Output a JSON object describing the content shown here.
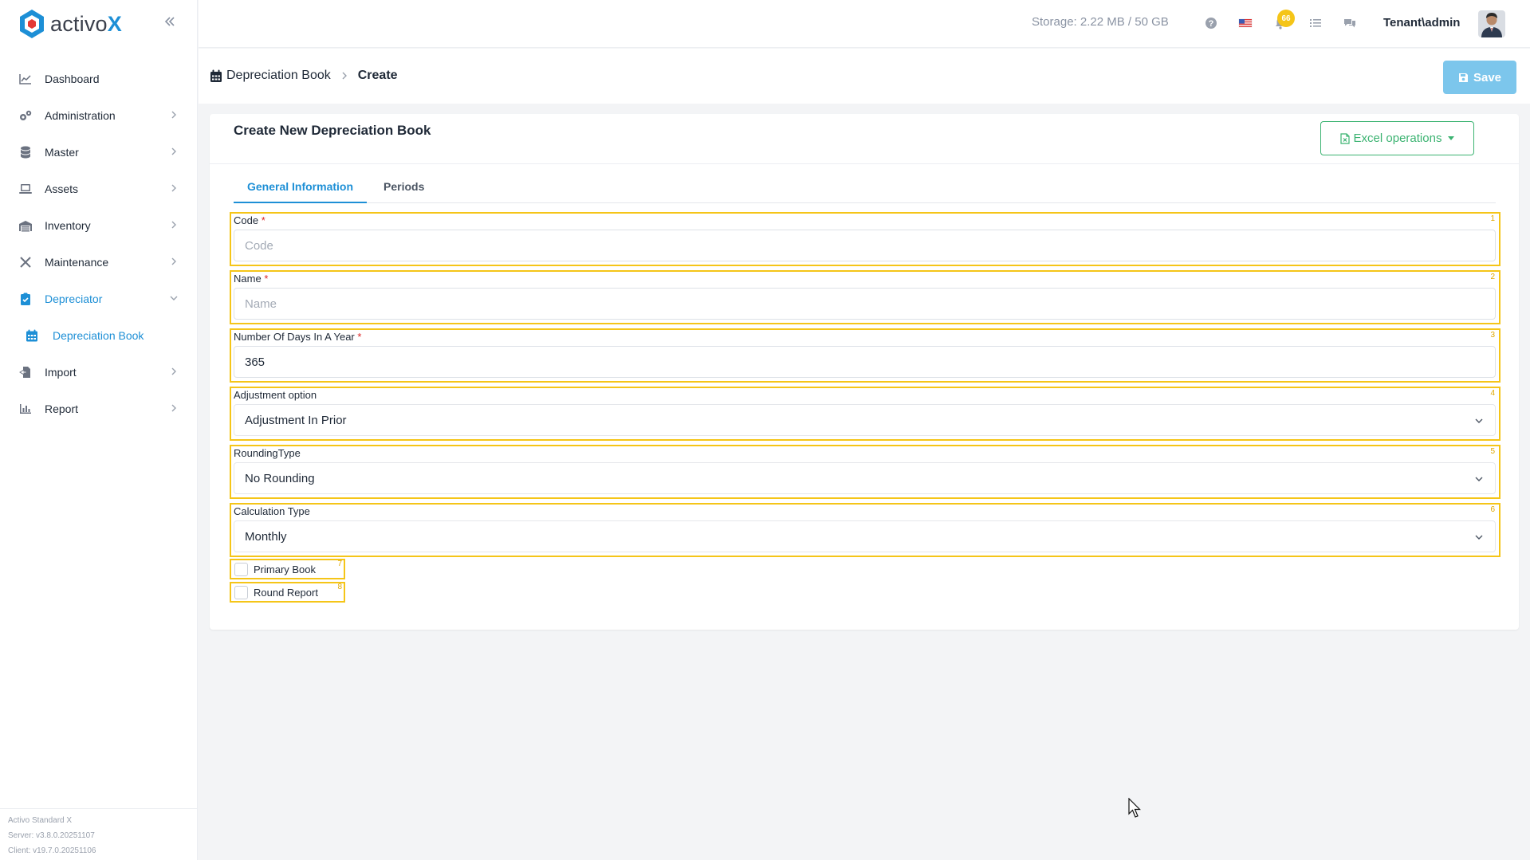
{
  "brand": {
    "name_main": "activo",
    "name_accent": "X"
  },
  "sidebar": {
    "items": [
      {
        "label": "Dashboard",
        "icon": "chart-line-icon",
        "has_chevron": false
      },
      {
        "label": "Administration",
        "icon": "gears-icon",
        "has_chevron": true
      },
      {
        "label": "Master",
        "icon": "database-icon",
        "has_chevron": true
      },
      {
        "label": "Assets",
        "icon": "laptop-icon",
        "has_chevron": true
      },
      {
        "label": "Inventory",
        "icon": "warehouse-icon",
        "has_chevron": true
      },
      {
        "label": "Maintenance",
        "icon": "tools-icon",
        "has_chevron": true
      },
      {
        "label": "Depreciator",
        "icon": "clipboard-icon",
        "has_chevron": true,
        "active": true
      },
      {
        "label": "Import",
        "icon": "file-import-icon",
        "has_chevron": true
      },
      {
        "label": "Report",
        "icon": "chart-bar-icon",
        "has_chevron": true
      }
    ],
    "subitem": {
      "label": "Depreciation Book",
      "icon": "calendar-icon"
    },
    "versions": {
      "product": "Activo Standard X",
      "server": "Server: v3.8.0.20251107",
      "client": "Client: v19.7.0.20251106"
    }
  },
  "topbar": {
    "storage": "Storage: 2.22 MB / 50 GB",
    "notification_count": "66",
    "user": "Tenant\\admin"
  },
  "breadcrumb": {
    "parent": "Depreciation Book",
    "current": "Create"
  },
  "actions": {
    "save_label": "Save"
  },
  "card": {
    "title": "Create New Depreciation Book",
    "excel_label": "Excel operations",
    "tabs": [
      "General Information",
      "Periods"
    ]
  },
  "form": {
    "code": {
      "label": "Code",
      "required": "*",
      "placeholder": "Code",
      "value": "",
      "index": "1"
    },
    "name": {
      "label": "Name",
      "required": "*",
      "placeholder": "Name",
      "value": "",
      "index": "2"
    },
    "days": {
      "label": "Number Of Days In A Year",
      "required": "*",
      "value": "365",
      "index": "3"
    },
    "adjustment": {
      "label": "Adjustment option",
      "value": "Adjustment In Prior",
      "index": "4"
    },
    "rounding": {
      "label": "RoundingType",
      "value": "No Rounding",
      "index": "5"
    },
    "calculation": {
      "label": "Calculation Type",
      "value": "Monthly",
      "index": "6"
    },
    "primary_book": {
      "label": "Primary Book",
      "checked": false,
      "index": "7"
    },
    "round_report": {
      "label": "Round Report",
      "checked": false,
      "index": "8"
    }
  },
  "colors": {
    "accent": "#1d8fd6",
    "save_button": "#7cc6ec",
    "excel_green": "#3bb371",
    "highlight_yellow": "#f5c518",
    "badge": "#f5c518",
    "required": "#dc2626"
  }
}
